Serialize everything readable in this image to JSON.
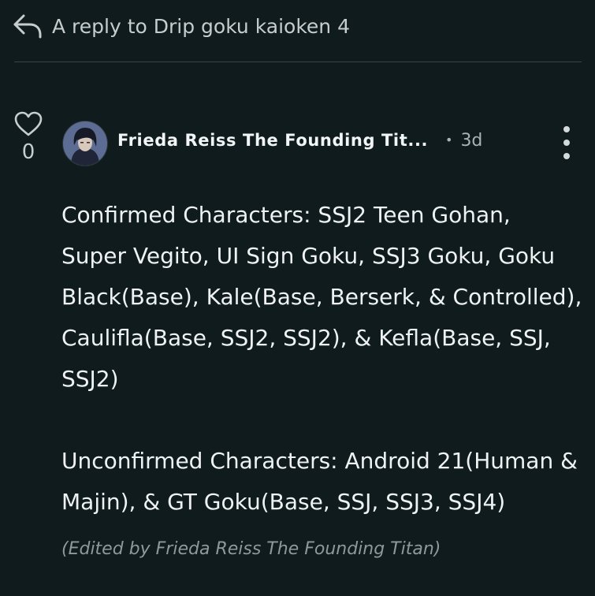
{
  "reply_header": {
    "icon": "reply-arrow-icon",
    "text": "A reply to Drip goku kaioken 4"
  },
  "post": {
    "like_icon": "heart-icon",
    "like_count": "0",
    "author": "Frieda Reiss The Founding Tit...",
    "age": "3d",
    "more_icon": "more-vertical-icon",
    "body": "Confirmed Characters: SSJ2 Teen Gohan,\nSuper Vegito, UI Sign Goku, SSJ3 Goku, Goku\nBlack(Base), Kale(Base, Berserk, & Controlled),\nCaulifla(Base, SSJ2, SSJ2), & Kefla(Base, SSJ,\nSSJ2)\n\nUnconfirmed Characters: Android 21(Human &\nMajin), & GT Goku(Base, SSJ, SSJ3, SSJ4)",
    "edited_note": "(Edited by Frieda Reiss The Founding Titan)"
  },
  "colors": {
    "background": "#0f1b1c",
    "text": "#eef2f2",
    "muted": "#aab3b3"
  }
}
